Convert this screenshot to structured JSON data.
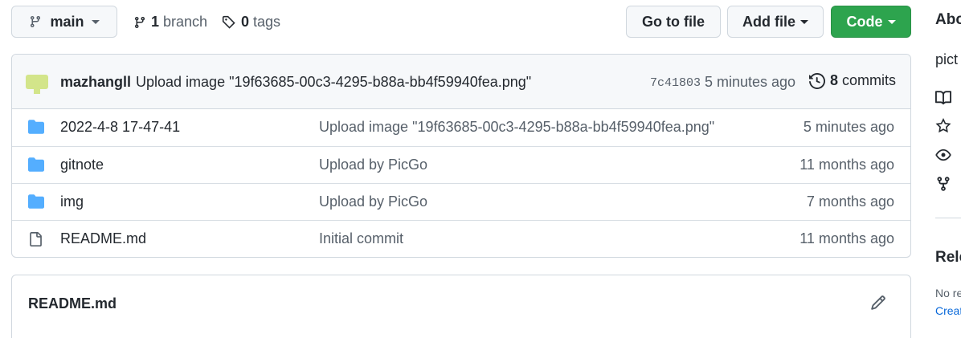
{
  "branch": {
    "label": "main"
  },
  "meta": {
    "branch_count": "1",
    "branch_word": "branch",
    "tag_count": "0",
    "tag_word": "tags"
  },
  "actions": {
    "goto_file": "Go to file",
    "add_file": "Add file",
    "code": "Code"
  },
  "commit": {
    "author": "mazhangll",
    "message": "Upload image \"19f63685-00c3-4295-b88a-bb4f59940fea.png\"",
    "sha": "7c41803",
    "time": "5 minutes ago",
    "commit_count": "8",
    "commit_word": "commits"
  },
  "files": [
    {
      "type": "folder",
      "name": "2022-4-8 17-47-41",
      "message": "Upload image \"19f63685-00c3-4295-b88a-bb4f59940fea.png\"",
      "age": "5 minutes ago"
    },
    {
      "type": "folder",
      "name": "gitnote",
      "message": "Upload by PicGo",
      "age": "11 months ago"
    },
    {
      "type": "folder",
      "name": "img",
      "message": "Upload by PicGo",
      "age": "7 months ago"
    },
    {
      "type": "file",
      "name": "README.md",
      "message": "Initial commit",
      "age": "11 months ago"
    }
  ],
  "readme": {
    "title": "README.md"
  },
  "sidebar": {
    "about_title": "Abo",
    "description": "pict",
    "icons": [
      "book-icon",
      "star-icon",
      "eye-icon",
      "fork-icon"
    ],
    "releases_title": "Rele",
    "no_releases": "No re",
    "create_link": "Creat"
  },
  "colors": {
    "accent_green": "#2da44e",
    "folder_blue": "#54aeff",
    "link_blue": "#0969da"
  }
}
